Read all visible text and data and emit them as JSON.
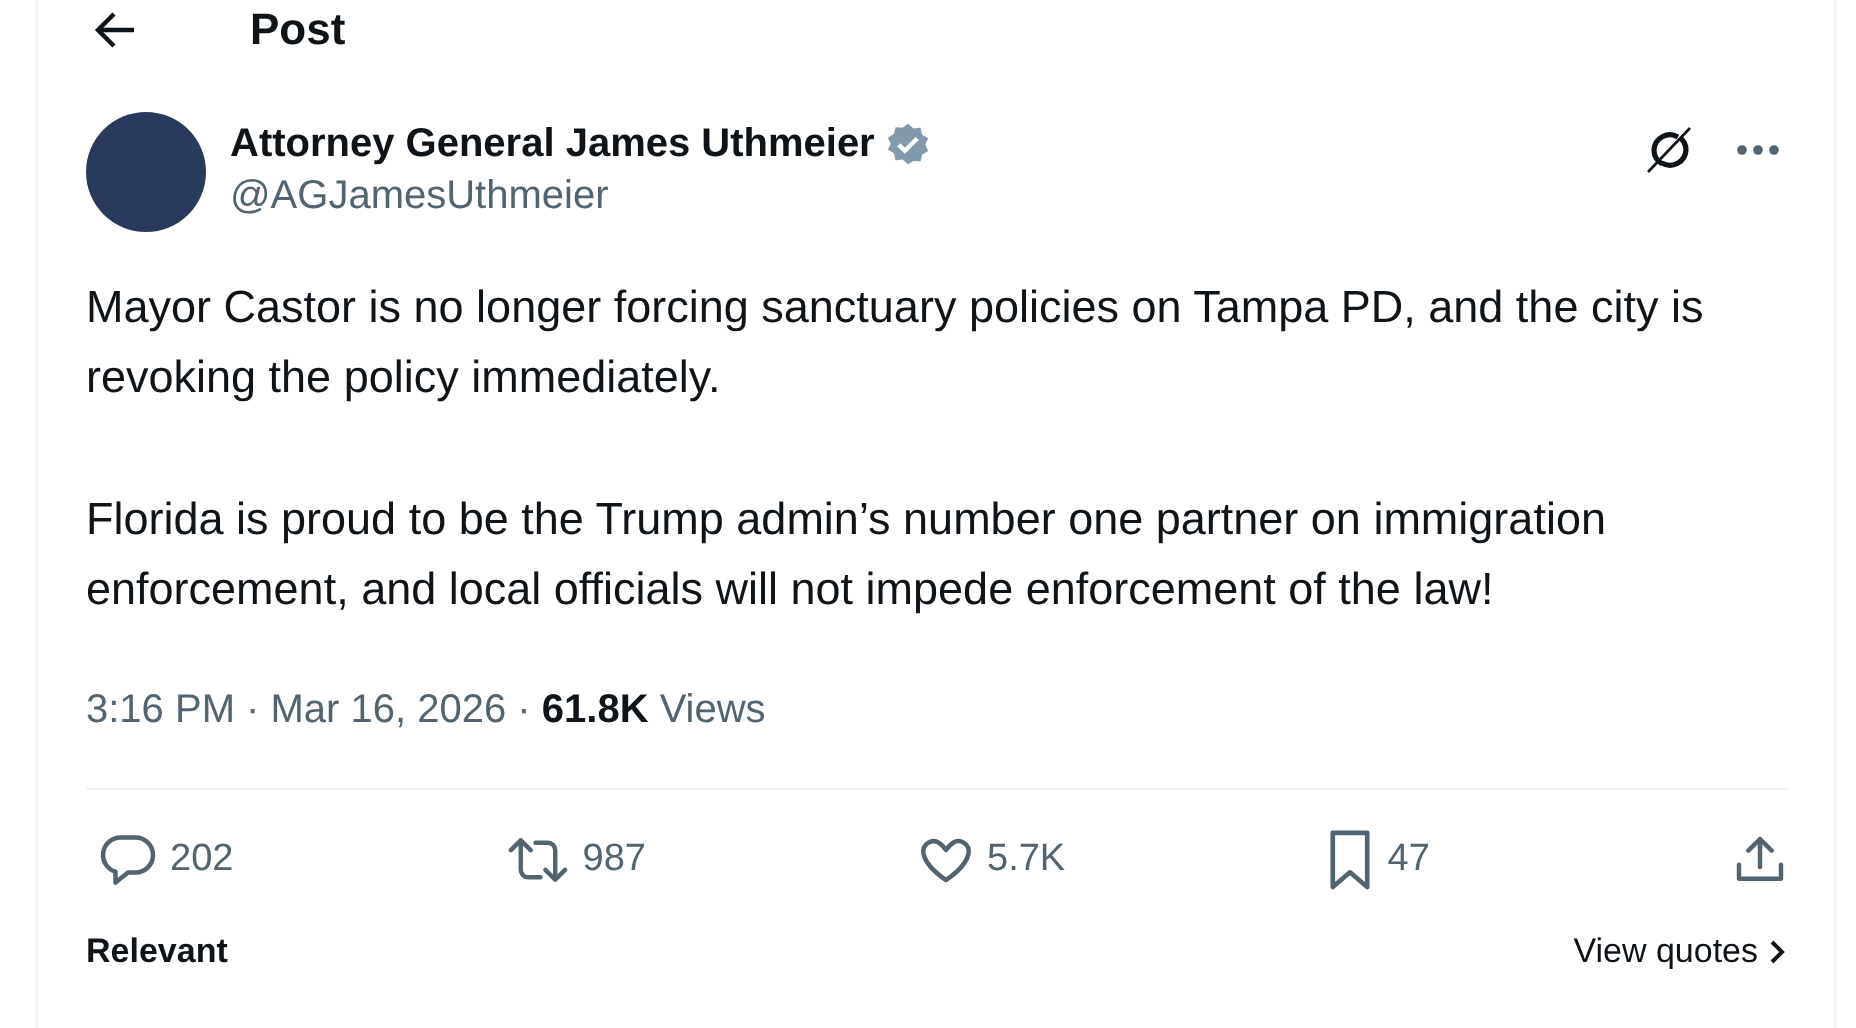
{
  "header": {
    "title": "Post"
  },
  "post": {
    "author": {
      "name": "Attorney General James Uthmeier",
      "handle": "@AGJamesUthmeier",
      "verified": true
    },
    "paragraphs": [
      "Mayor Castor is no longer forcing sanctuary policies on Tampa PD, and the city is revoking the policy immediately.",
      "Florida is proud to be the Trump admin’s number one partner on immigration enforcement, and local officials will not impede enforcement of the law!"
    ],
    "timestamp": "3:16 PM · Mar 16, 2026 · ",
    "views_count": "61.8K",
    "views_label": "Views",
    "actions": [
      {
        "kind": "reply",
        "count": "202"
      },
      {
        "kind": "repost",
        "count": "987"
      },
      {
        "kind": "like",
        "count": "5.7K"
      },
      {
        "kind": "bookmark",
        "count": "47"
      },
      {
        "kind": "share"
      }
    ]
  },
  "footer": {
    "left": "Relevant",
    "right": "View quotes"
  }
}
